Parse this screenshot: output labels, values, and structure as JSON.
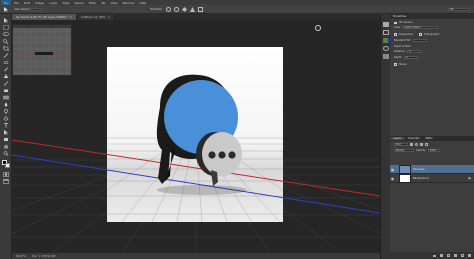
{
  "app": {
    "logo": "Ps"
  },
  "menu": [
    "File",
    "Edit",
    "Image",
    "Layer",
    "Type",
    "Select",
    "Filter",
    "3D",
    "View",
    "Window",
    "Help"
  ],
  "options_bar": {
    "mode_label": "3D Mode:",
    "workspace": "3D"
  },
  "tabs": [
    {
      "label": "bg-3d.psd @ 66.7% (3D Layer, RGB/8) *",
      "active": true
    },
    {
      "label": "Untitled-1 @ 100%",
      "active": false
    }
  ],
  "status": {
    "zoom": "66.67%",
    "info": "Doc: 1.37M/12.4M"
  },
  "properties_panel": {
    "title": "Properties",
    "subtitle": "3D Camera",
    "rows": [
      {
        "label": "View:",
        "value": "Custom View 1"
      },
      {
        "label": "Perspective",
        "value": ""
      },
      {
        "label": "Orthographic",
        "value": ""
      },
      {
        "label": "Standard FOV",
        "value": ""
      },
      {
        "label": "Depth of Field",
        "value": ""
      },
      {
        "label": "Distance:",
        "value": "0"
      },
      {
        "label": "Depth:",
        "value": "0"
      },
      {
        "label": "Stereo",
        "value": ""
      }
    ]
  },
  "layers_panel": {
    "tabs": [
      "Layers",
      "Channels",
      "Paths"
    ],
    "kind_label": "Kind",
    "blend_mode": "Normal",
    "opacity_label": "Opacity:",
    "opacity": "100%",
    "layers": [
      {
        "name": "3D Layer",
        "selected": true
      },
      {
        "name": "Background",
        "selected": false
      }
    ]
  },
  "colors": {
    "accent": "#4a8fd6",
    "selection": "#4f6f93",
    "bubble_main": "#4a90d9",
    "bubble_small": "#c9c9c9"
  }
}
